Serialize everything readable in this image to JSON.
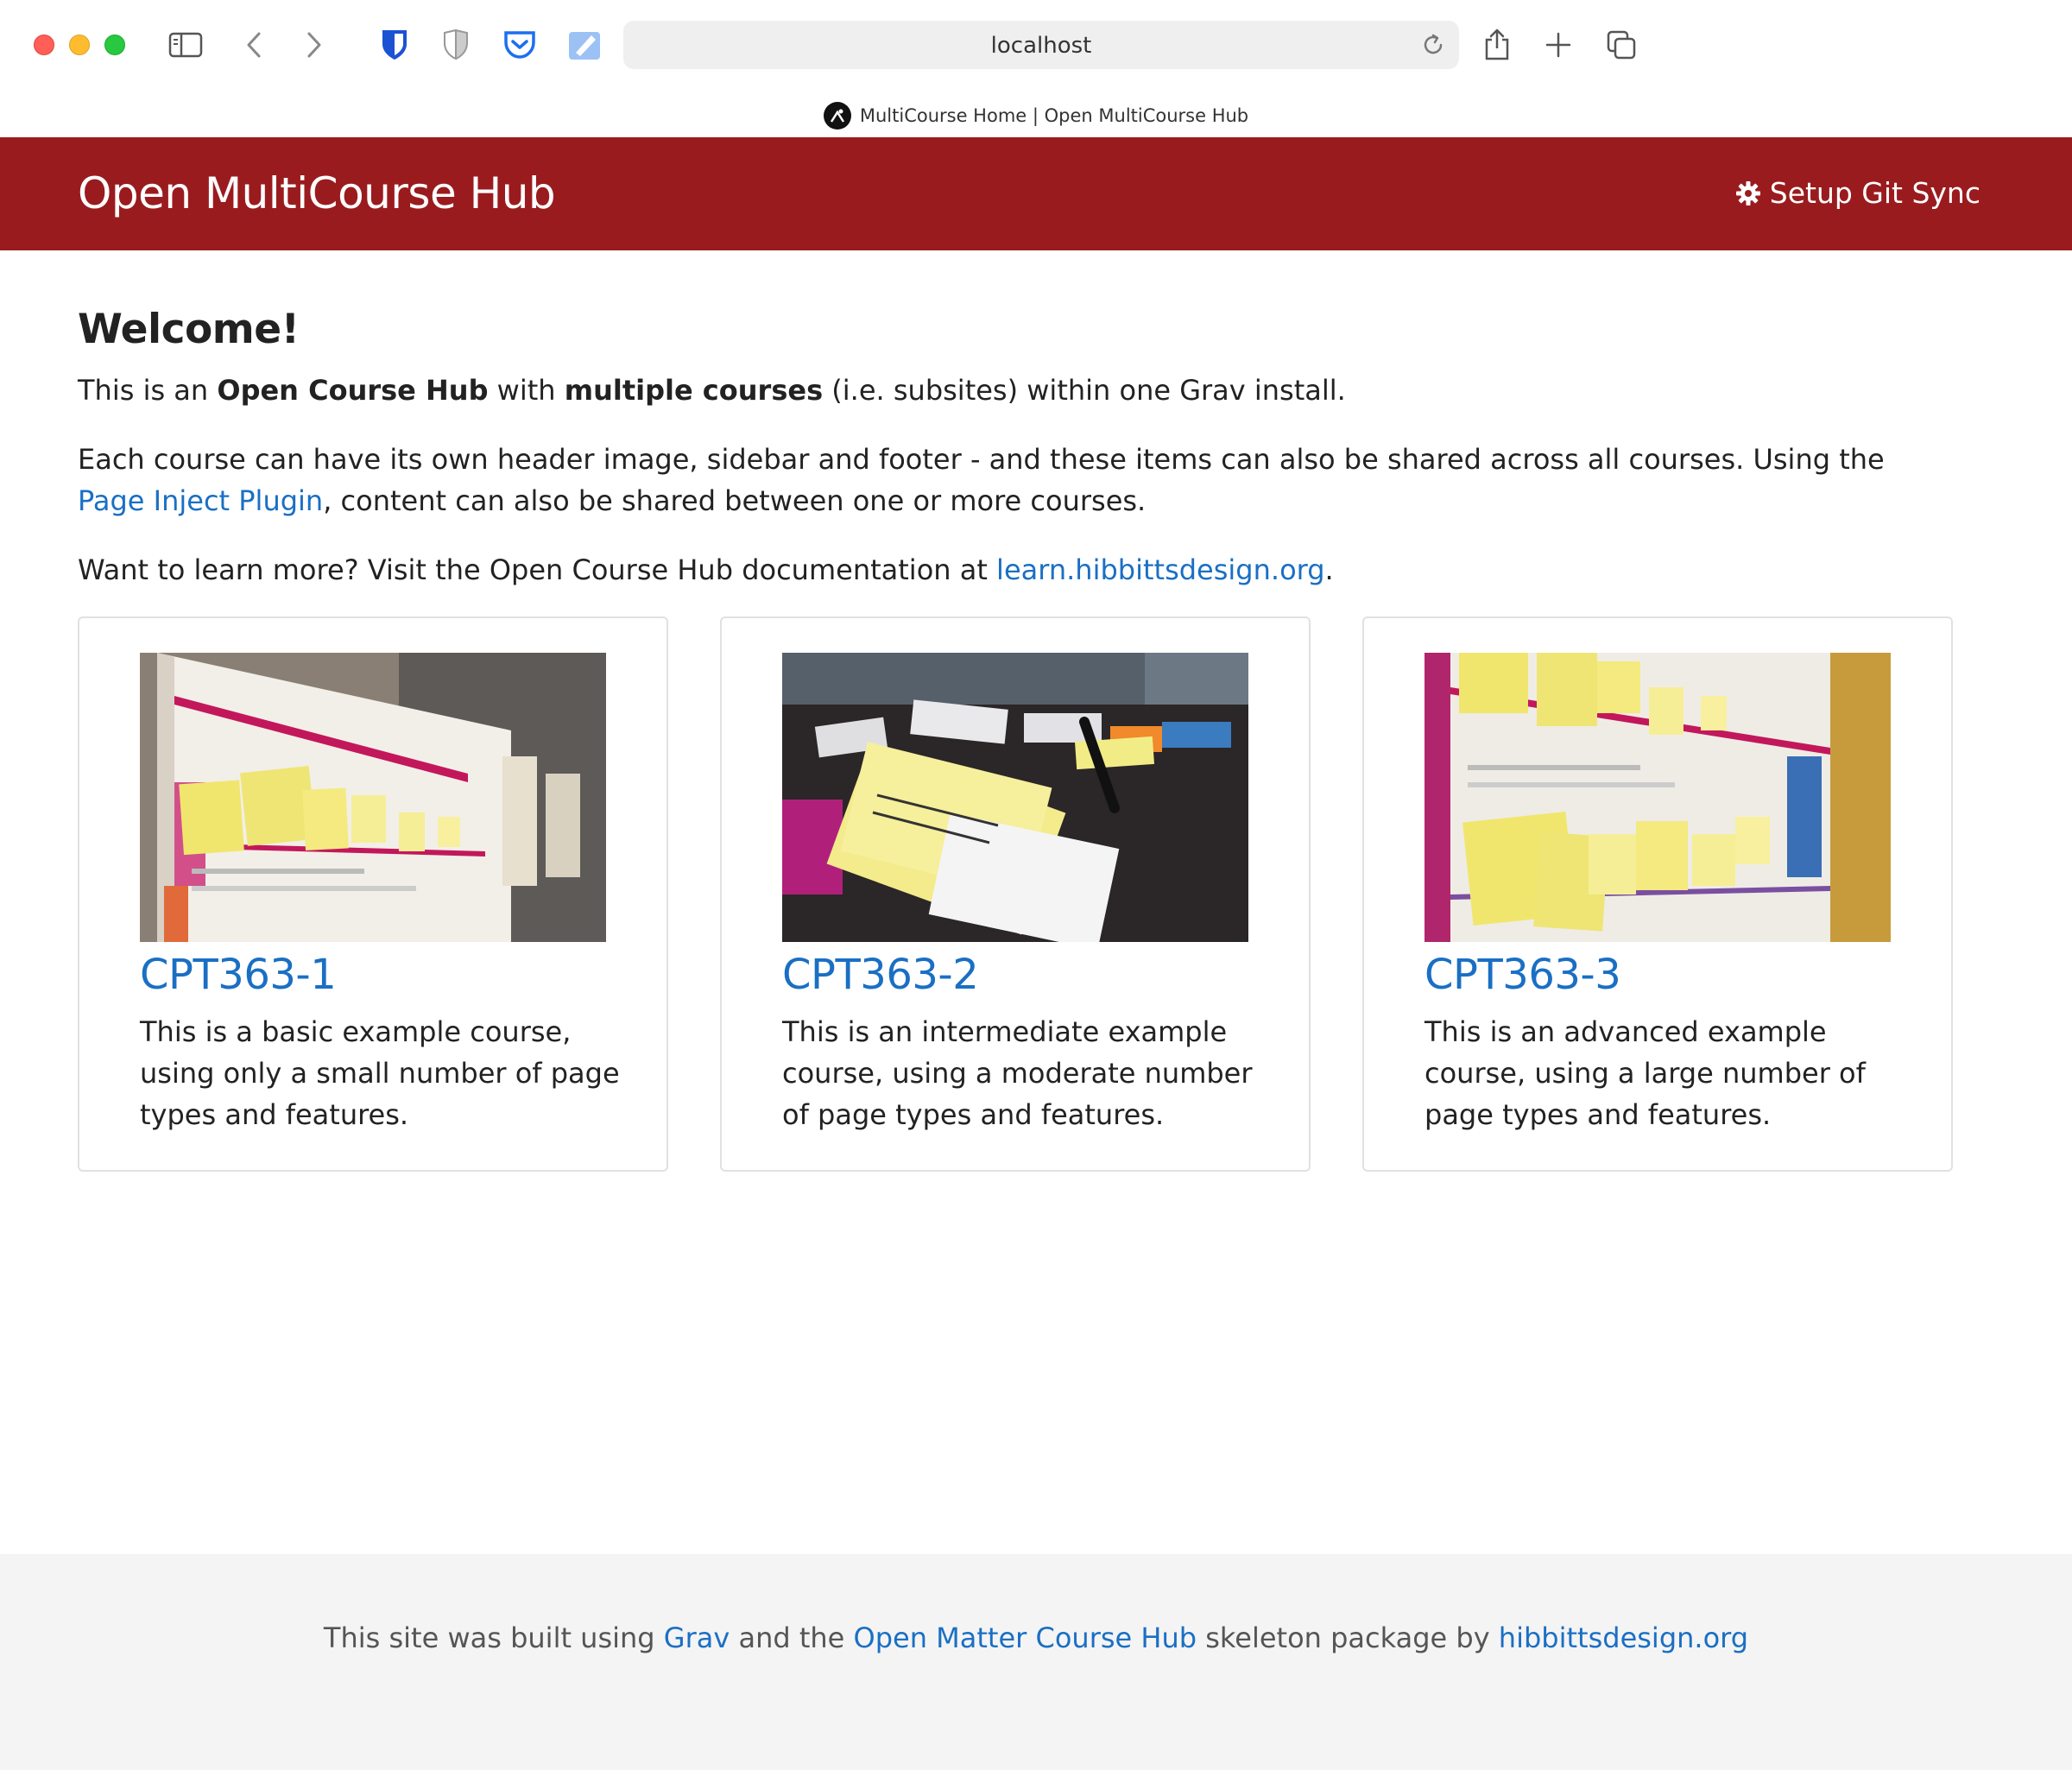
{
  "browser": {
    "url": "localhost",
    "tab_title": "MultiCourse Home | Open MultiCourse Hub"
  },
  "header": {
    "site_title": "Open MultiCourse Hub",
    "git_sync_label": "Setup Git Sync",
    "bg_color": "#9a1b1e"
  },
  "main": {
    "welcome_heading": "Welcome!",
    "intro": {
      "t1": "This is an ",
      "b1": "Open Course Hub",
      "t2": " with ",
      "b2": "multiple courses",
      "t3": " (i.e. subsites) within one Grav install."
    },
    "shared": {
      "t1": "Each course can have its own header image, sidebar and footer - and these items can also be shared across all courses. Using the ",
      "link": "Page Inject Plugin",
      "t2": ", content can also be shared between one or more courses."
    },
    "learn": {
      "t1": "Want to learn more? Visit the Open Course Hub documentation at ",
      "link": "learn.hibbittsdesign.org",
      "t2": "."
    }
  },
  "courses": [
    {
      "title": "CPT363-1",
      "description": "This is a basic example course, using only a small number of page types and features."
    },
    {
      "title": "CPT363-2",
      "description": "This is an intermediate example course, using a moderate number of page types and features."
    },
    {
      "title": "CPT363-3",
      "description": "This is an advanced example course, using a large number of page types and features."
    }
  ],
  "footer": {
    "t1": "This site was built using ",
    "link1": "Grav",
    "t2": " and the ",
    "link2": "Open Matter Course Hub",
    "t3": " skeleton package by ",
    "link3": "hibbittsdesign.org"
  },
  "colors": {
    "link": "#1a6fc4",
    "footer_bg": "#f4f4f4"
  }
}
